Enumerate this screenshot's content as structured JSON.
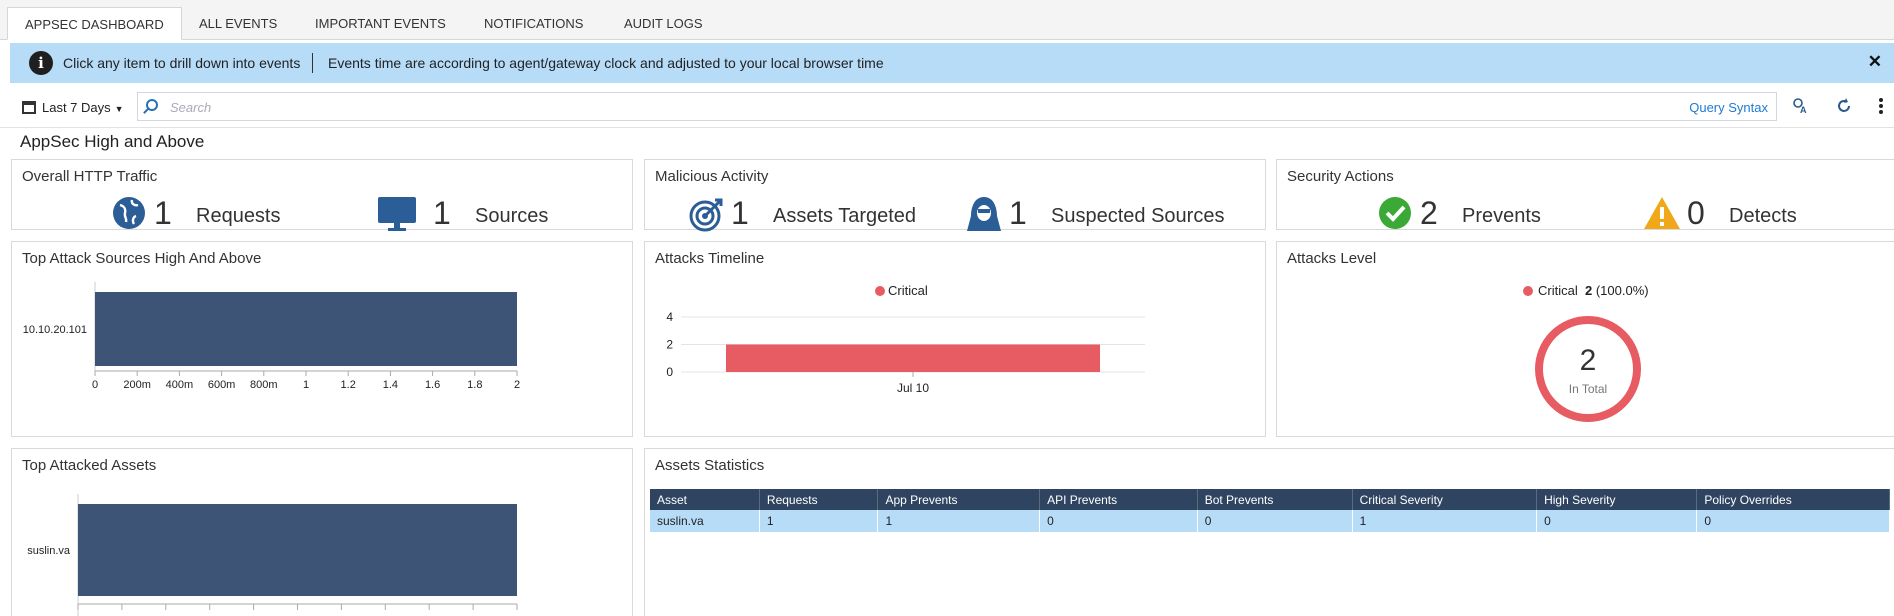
{
  "tabs": [
    {
      "label": "AppSec Dashboard",
      "active": true
    },
    {
      "label": "All Events",
      "active": false
    },
    {
      "label": "Important Events",
      "active": false
    },
    {
      "label": "Notifications",
      "active": false
    },
    {
      "label": "Audit Logs",
      "active": false
    }
  ],
  "banner": {
    "text1": "Click any item to drill down into events",
    "text2": "Events time are according to agent/gateway clock and adjusted to your local browser time",
    "close": "✕"
  },
  "toolbar": {
    "date_range": "Last 7 Days",
    "search_placeholder": "Search",
    "query_syntax": "Query Syntax"
  },
  "section_title": "AppSec High and Above",
  "overall_http": {
    "title": "Overall HTTP Traffic",
    "requests_value": "1",
    "requests_label": "Requests",
    "sources_value": "1",
    "sources_label": "Sources"
  },
  "malicious": {
    "title": "Malicious Activity",
    "assets_value": "1",
    "assets_label": "Assets Targeted",
    "suspected_value": "1",
    "suspected_label": "Suspected Sources"
  },
  "security_actions": {
    "title": "Security Actions",
    "prevents_value": "2",
    "prevents_label": "Prevents",
    "detects_value": "0",
    "detects_label": "Detects"
  },
  "top_sources": {
    "title": "Top Attack Sources High And Above"
  },
  "timeline": {
    "title": "Attacks Timeline"
  },
  "attacks_level": {
    "title": "Attacks Level",
    "legend_name": "Critical",
    "legend_count": "2",
    "legend_pct": "(100.0%)",
    "total": "2",
    "total_label": "In Total"
  },
  "top_assets": {
    "title": "Top Attacked Assets"
  },
  "assets_stats": {
    "title": "Assets Statistics",
    "columns": [
      "Asset",
      "Requests",
      "App Prevents",
      "API Prevents",
      "Bot Prevents",
      "Critical Severity",
      "High Severity",
      "Policy Overrides"
    ],
    "rows": [
      [
        "suslin.va",
        "1",
        "1",
        "0",
        "0",
        "1",
        "0",
        "0"
      ]
    ]
  },
  "colors": {
    "bar": "#3d5476",
    "critical": "#e75b62",
    "header": "#2f4461",
    "row": "#b7dcf8"
  },
  "chart_data": [
    {
      "type": "bar",
      "orientation": "horizontal",
      "categories": [
        "10.10.20.101"
      ],
      "values": [
        2
      ],
      "xlim": [
        0,
        2
      ],
      "xticks": [
        "0",
        "200m",
        "400m",
        "600m",
        "800m",
        "1",
        "1.2",
        "1.4",
        "1.6",
        "1.8",
        "2"
      ]
    },
    {
      "type": "bar",
      "categories": [
        "Jul 10"
      ],
      "series": [
        {
          "name": "Critical",
          "values": [
            2
          ]
        }
      ],
      "ylim": [
        0,
        4
      ],
      "yticks": [
        "0",
        "2",
        "4"
      ],
      "legend": "top"
    },
    {
      "type": "pie",
      "categories": [
        "Critical"
      ],
      "values": [
        2
      ],
      "percent": [
        100.0
      ]
    },
    {
      "type": "bar",
      "orientation": "horizontal",
      "categories": [
        "suslin.va"
      ],
      "values": [
        2
      ]
    }
  ]
}
